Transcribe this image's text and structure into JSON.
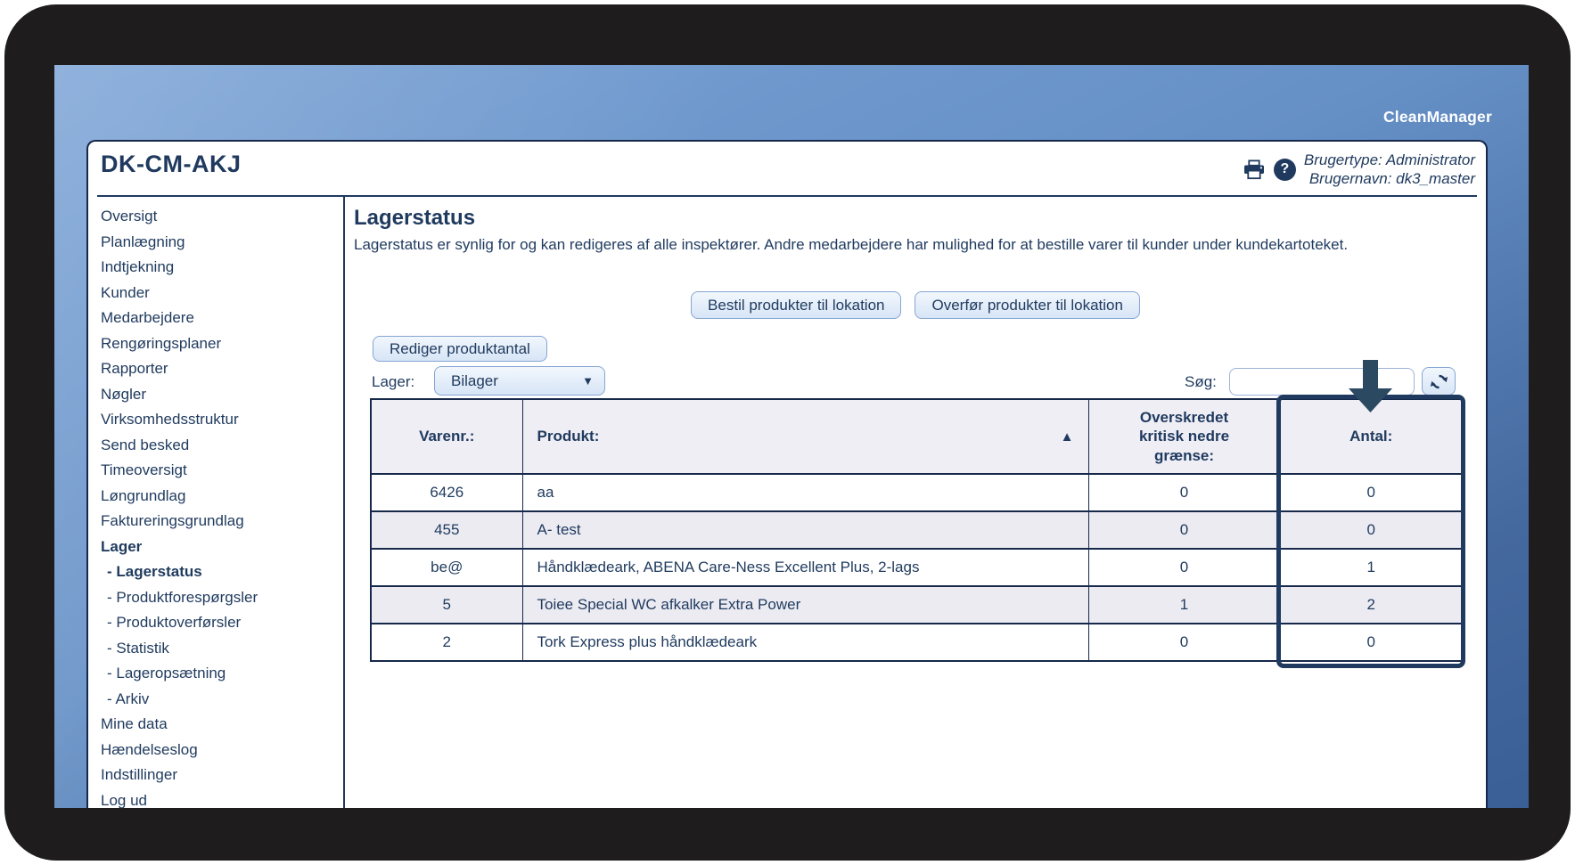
{
  "logo": "CleanManager",
  "header": {
    "title": "DK-CM-AKJ",
    "user_type": "Brugertype: Administrator",
    "user_name": "Brugernavn: dk3_master"
  },
  "sidebar": {
    "items": [
      {
        "label": "Oversigt",
        "bold": false,
        "sub": false
      },
      {
        "label": "Planlægning",
        "bold": false,
        "sub": false
      },
      {
        "label": "Indtjekning",
        "bold": false,
        "sub": false
      },
      {
        "label": "Kunder",
        "bold": false,
        "sub": false
      },
      {
        "label": "Medarbejdere",
        "bold": false,
        "sub": false
      },
      {
        "label": "Rengøringsplaner",
        "bold": false,
        "sub": false
      },
      {
        "label": "Rapporter",
        "bold": false,
        "sub": false
      },
      {
        "label": "Nøgler",
        "bold": false,
        "sub": false
      },
      {
        "label": "Virksomhedsstruktur",
        "bold": false,
        "sub": false
      },
      {
        "label": "Send besked",
        "bold": false,
        "sub": false
      },
      {
        "label": "Timeoversigt",
        "bold": false,
        "sub": false
      },
      {
        "label": "Løngrundlag",
        "bold": false,
        "sub": false
      },
      {
        "label": "Faktureringsgrundlag",
        "bold": false,
        "sub": false
      },
      {
        "label": "Lager",
        "bold": true,
        "sub": false
      },
      {
        "label": "- Lagerstatus",
        "bold": true,
        "sub": true
      },
      {
        "label": "- Produktforespørgsler",
        "bold": false,
        "sub": true
      },
      {
        "label": "- Produktoverførsler",
        "bold": false,
        "sub": true
      },
      {
        "label": "- Statistik",
        "bold": false,
        "sub": true
      },
      {
        "label": "- Lageropsætning",
        "bold": false,
        "sub": true
      },
      {
        "label": "- Arkiv",
        "bold": false,
        "sub": true
      },
      {
        "label": "Mine data",
        "bold": false,
        "sub": false
      },
      {
        "label": "Hændelseslog",
        "bold": false,
        "sub": false
      },
      {
        "label": "Indstillinger",
        "bold": false,
        "sub": false
      },
      {
        "label": "Log ud",
        "bold": false,
        "sub": false
      }
    ]
  },
  "main": {
    "title": "Lagerstatus",
    "description": "Lagerstatus er synlig for og kan redigeres af alle inspektører. Andre medarbejdere har mulighed for at bestille varer til kunder under kundekartoteket.",
    "buttons": {
      "order": "Bestil produkter til lokation",
      "transfer": "Overfør produkter til lokation",
      "edit_quantity": "Rediger produktantal"
    },
    "filters": {
      "lager_label": "Lager:",
      "lager_value": "Bilager",
      "caret": "▼",
      "search_label": "Søg:",
      "search_value": ""
    }
  },
  "table": {
    "columns": [
      "Varenr.:",
      "Produkt:",
      "Overskredet kritisk nedre grænse:",
      "Antal:"
    ],
    "sorted_column": "Produkt:",
    "sort_indicator": "▲",
    "highlighted_column": "Antal:",
    "rows": [
      {
        "varenr": "6426",
        "produkt": "aa",
        "overskredet": "0",
        "antal": "0"
      },
      {
        "varenr": "455",
        "produkt": "A- test",
        "overskredet": "0",
        "antal": "0"
      },
      {
        "varenr": "be@",
        "produkt": "Håndklædeark, ABENA Care-Ness Excellent Plus, 2-lags",
        "overskredet": "0",
        "antal": "1"
      },
      {
        "varenr": "5",
        "produkt": "Toiee Special WC afkalker Extra Power",
        "overskredet": "1",
        "antal": "2"
      },
      {
        "varenr": "2",
        "produkt": "Tork Express plus håndklædeark",
        "overskredet": "0",
        "antal": "0"
      }
    ]
  },
  "colors": {
    "accent_navy": "#1f3a5e",
    "table_border": "#16294a",
    "header_row_bg": "#efeef5",
    "alt_row_bg": "#ecebf2",
    "button_border": "#86a5d3",
    "frame_black": "#1e1c1c",
    "desktop_blue_top": "#7ba3d6",
    "desktop_blue_bottom": "#3a5f97",
    "arrow_navy": "#2b4961"
  }
}
